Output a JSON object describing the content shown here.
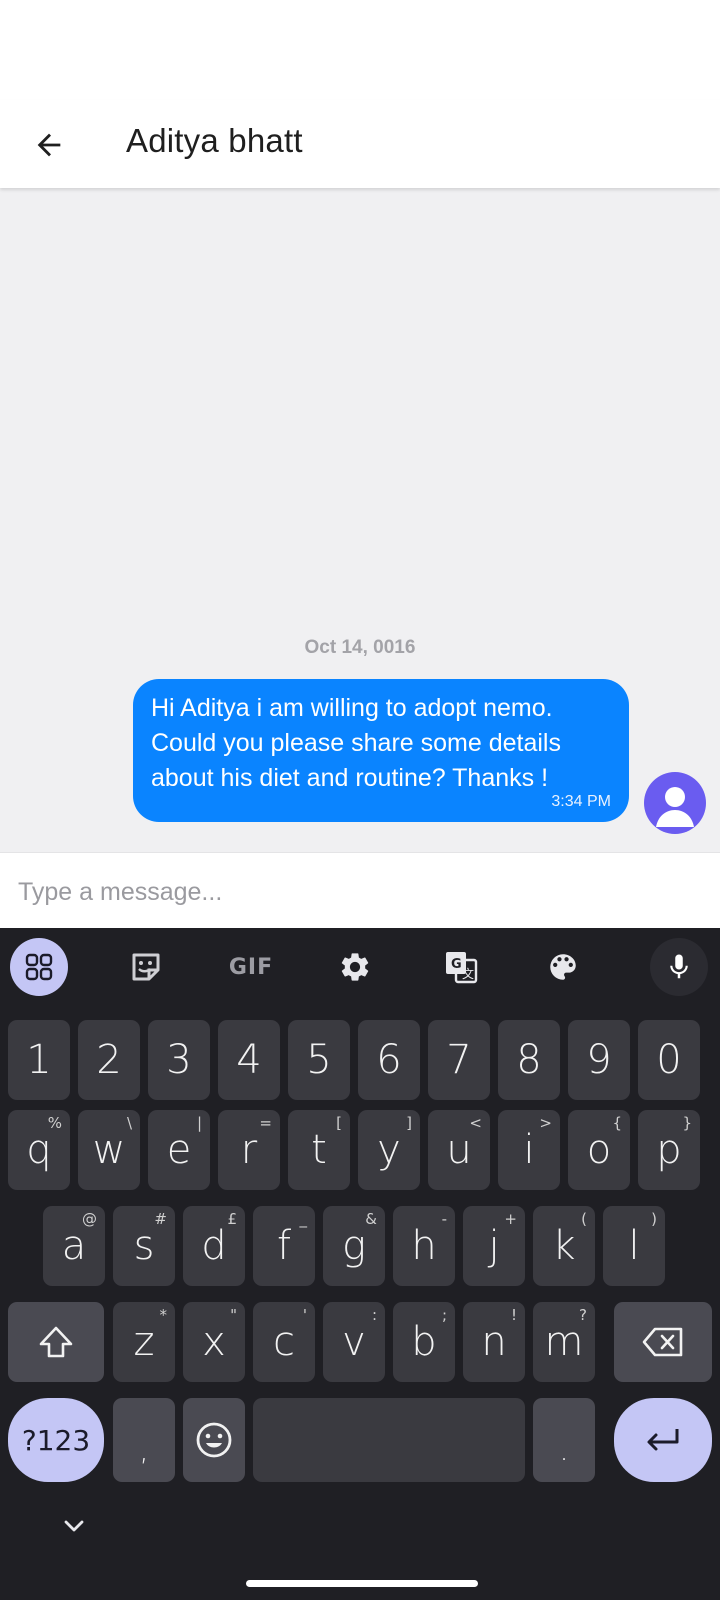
{
  "header": {
    "title": "Aditya bhatt"
  },
  "chat": {
    "date_label": "Oct 14, 0016",
    "messages": [
      {
        "text": "Hi Aditya i am willing to adopt nemo. Could you please share some details about his diet and routine? Thanks !",
        "time": "3:34 PM"
      }
    ]
  },
  "composer": {
    "placeholder": "Type a message..."
  },
  "keyboard": {
    "toolbar": [
      "apps-icon",
      "sticker-icon",
      "GIF",
      "gear-icon",
      "translate-icon",
      "palette-icon",
      "microphone-icon"
    ],
    "gif_label": "GIF",
    "row_numbers": [
      "1",
      "2",
      "3",
      "4",
      "5",
      "6",
      "7",
      "8",
      "9",
      "0"
    ],
    "row1": [
      "q",
      "w",
      "e",
      "r",
      "t",
      "y",
      "u",
      "i",
      "o",
      "p"
    ],
    "row1_hints": [
      "%",
      "\\",
      "|",
      "=",
      "[",
      "]",
      "<",
      ">",
      "{",
      "}"
    ],
    "row2": [
      "a",
      "s",
      "d",
      "f",
      "g",
      "h",
      "j",
      "k",
      "l"
    ],
    "row2_hints": [
      "@",
      "#",
      "£",
      "_",
      "&",
      "-",
      "+",
      "(",
      ")"
    ],
    "row3": [
      "z",
      "x",
      "c",
      "v",
      "b",
      "n",
      "m"
    ],
    "row3_hints": [
      "*",
      "\"",
      "'",
      ":",
      ";",
      "!",
      "?"
    ],
    "sym_label": "?123",
    "comma": ",",
    "period": ".",
    "colors": {
      "accent": "#c4c6f5",
      "bubble": "#0a84ff",
      "key": "#3a3a40"
    }
  }
}
